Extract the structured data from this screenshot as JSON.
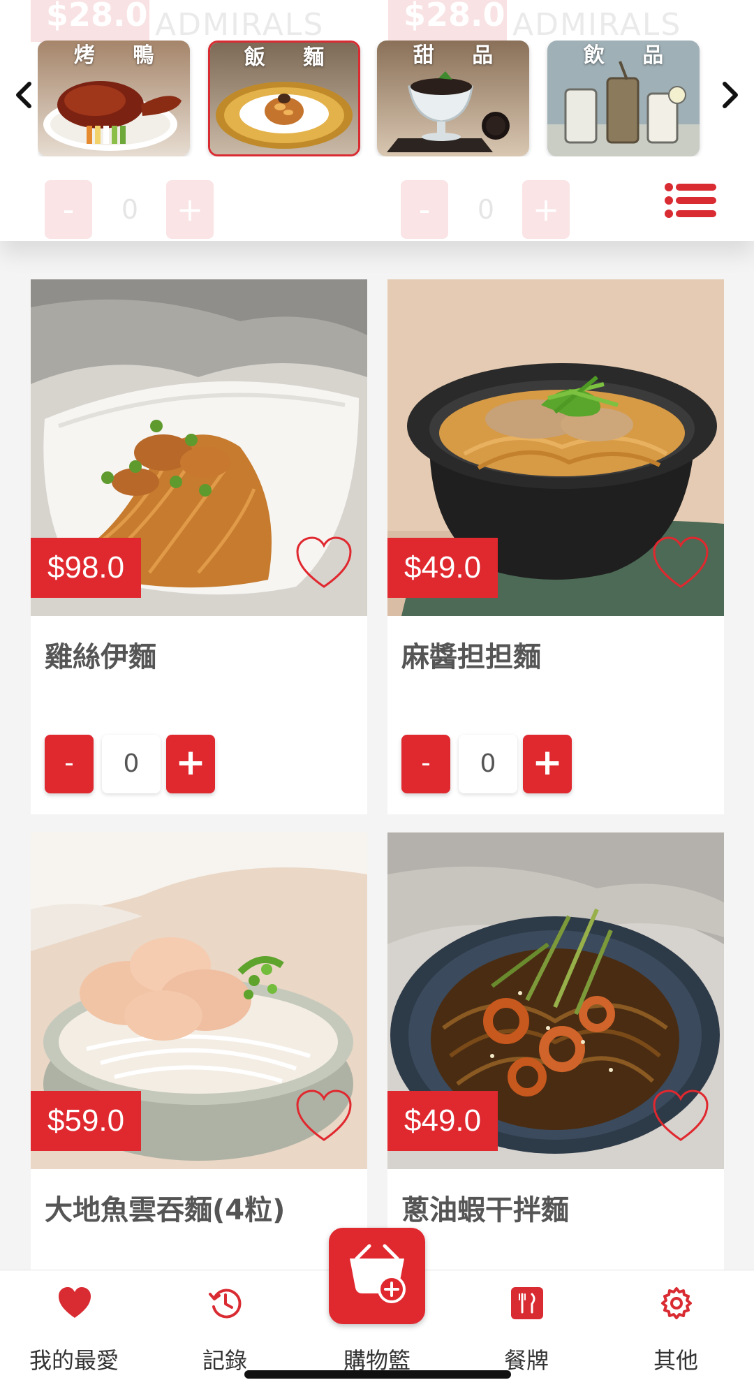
{
  "ghost_row": {
    "price_left": "$28.0",
    "brand_left": "ADMIRALS",
    "price_right": "$28.0",
    "brand_right": "ADMIRALS",
    "qty_left": "0",
    "qty_right": "0"
  },
  "categories": [
    {
      "label": "烤 鴨",
      "selected": false
    },
    {
      "label": "飯 麵",
      "selected": true
    },
    {
      "label": "甜 品",
      "selected": false
    },
    {
      "label": "飲 品",
      "selected": false
    }
  ],
  "nav_arrows": {
    "prev": "chevron-left-icon",
    "next": "chevron-right-icon"
  },
  "list_toggle_icon": "list-icon",
  "products": [
    {
      "name": "雞絲伊麵",
      "price": "$98.0",
      "quantity": "0",
      "minus": "-",
      "plus": "+",
      "favorite": false
    },
    {
      "name": "麻醬担担麵",
      "price": "$49.0",
      "quantity": "0",
      "minus": "-",
      "plus": "+",
      "favorite": false
    },
    {
      "name": "大地魚雲吞麵(4粒)",
      "price": "$59.0",
      "favorite": false
    },
    {
      "name": "蔥油蝦干拌麵",
      "price": "$49.0",
      "favorite": false
    }
  ],
  "bottom_nav": [
    {
      "label": "我的最愛",
      "icon": "heart-icon"
    },
    {
      "label": "記錄",
      "icon": "clock-history-icon"
    },
    {
      "label": "購物籃",
      "icon": "basket-add-icon"
    },
    {
      "label": "餐牌",
      "icon": "menu-card-icon"
    },
    {
      "label": "其他",
      "icon": "gear-icon"
    }
  ],
  "colors": {
    "accent": "#e0282f",
    "nav_icon_accent": "#d92b32",
    "background": "#f4f4f4"
  }
}
